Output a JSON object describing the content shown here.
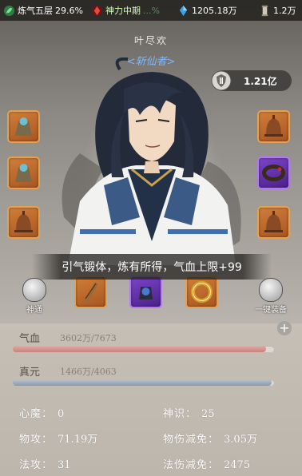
{
  "topbar": {
    "realm": {
      "label": "炼气五层",
      "value": "29.6%"
    },
    "divine": {
      "label": "神力中期",
      "value": "...%"
    },
    "spirit_stones": {
      "value": "1205.18万"
    },
    "scrolls": {
      "value": "1.2万"
    }
  },
  "character": {
    "name": "叶尽欢",
    "rank": "<斩仙者>"
  },
  "power": {
    "value": "1.21亿"
  },
  "equipment": {
    "left": [
      "bell-armor-icon",
      "bell-armor-icon",
      "copper-bell-icon"
    ],
    "right": [
      "copper-bell-icon",
      "dragon-bracelet-icon",
      "copper-bell-icon"
    ],
    "bottom": [
      "wooden-talisman-icon",
      "purple-treasure-icon",
      "gold-ring-icon"
    ]
  },
  "toast": {
    "text": "引气锻体，炼有所得，气血上限+99"
  },
  "side_buttons": {
    "left_label": "神通",
    "right_label": "一键装备"
  },
  "bars": {
    "hp": {
      "label": "气血",
      "value": "3602万/7673",
      "fill": 0.97
    },
    "mp": {
      "label": "真元",
      "value": "1466万/4063",
      "fill": 0.99
    }
  },
  "stats": {
    "demon": {
      "label": "心魔：",
      "value": "0"
    },
    "sense": {
      "label": "神识：",
      "value": "25"
    },
    "phys_atk": {
      "label": "物攻：",
      "value": "71.19万"
    },
    "phys_res": {
      "label": "物伤减免：",
      "value": "3.05万"
    },
    "magic_atk": {
      "label": "法攻：",
      "value": "31"
    },
    "magic_res": {
      "label": "法伤减免：",
      "value": "2475"
    }
  },
  "colors": {
    "accent_orange": "#e2a254",
    "accent_purple": "#b37af0",
    "hp": "#c9827c",
    "mp": "#8b99a8"
  }
}
